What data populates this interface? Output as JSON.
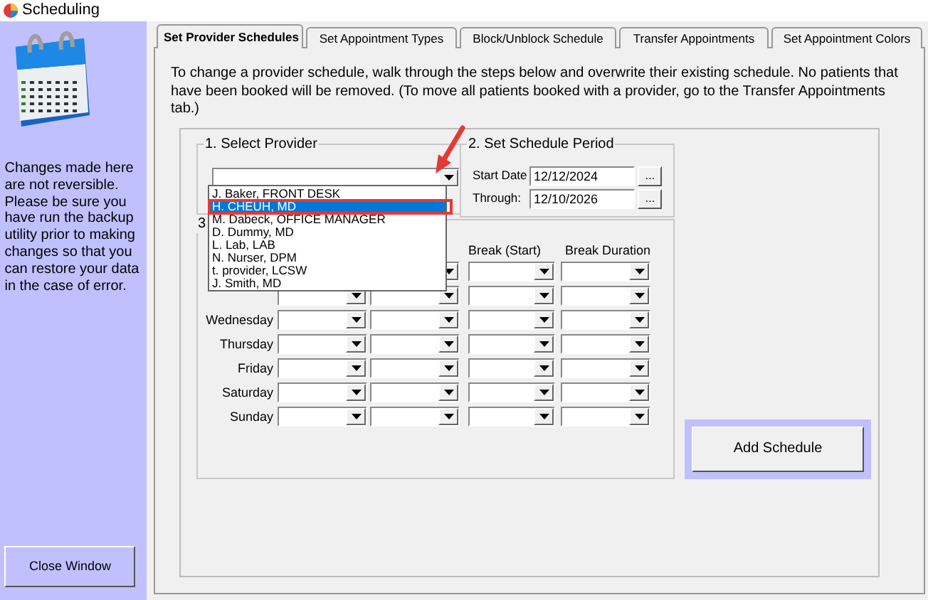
{
  "window": {
    "title": "Scheduling"
  },
  "sidebar": {
    "note": "Changes made here are not reversible. Please be sure you have run the backup utility prior to making changes so that you can restore your data in the case of error.",
    "close_button": {
      "label": "Close Window"
    }
  },
  "tabs": [
    {
      "label": "Set Provider Schedules",
      "selected": true
    },
    {
      "label": "Set Appointment Types",
      "selected": false
    },
    {
      "label": "Block/Unblock Schedule",
      "selected": false
    },
    {
      "label": "Transfer Appointments",
      "selected": false
    },
    {
      "label": "Set Appointment Colors",
      "selected": false
    }
  ],
  "instructions": "To change a provider schedule, walk through the steps below and overwrite their existing schedule. No patients that have been booked will be removed. (To move all patients booked with a provider, go to the Transfer Appointments tab.)",
  "select_provider": {
    "title": "1. Select Provider",
    "expanded": true,
    "options": [
      {
        "label": "J. Baker, FRONT DESK",
        "selected": false
      },
      {
        "label": "H. CHEUH, MD",
        "selected": true
      },
      {
        "label": "M. Dabeck, OFFICE MANAGER",
        "selected": false
      },
      {
        "label": "D. Dummy, MD",
        "selected": false
      },
      {
        "label": "L. Lab, LAB",
        "selected": false
      },
      {
        "label": "N. Nurser, DPM",
        "selected": false
      },
      {
        "label": "t. provider, LCSW",
        "selected": false
      },
      {
        "label": "J. Smith, MD",
        "selected": false
      }
    ]
  },
  "schedule_period": {
    "title": "2. Set Schedule Period",
    "start_label": "Start Date",
    "start_value": "12/12/2024",
    "through_label": "Through:",
    "through_value": "12/10/2026",
    "picker_label": "..."
  },
  "weekly_schedule": {
    "title": "3",
    "columns": [
      "Break (Start)",
      "Break Duration"
    ],
    "rows": [
      {},
      {},
      {
        "day": "Wednesday"
      },
      {
        "day": "Thursday"
      },
      {
        "day": "Friday"
      },
      {
        "day": "Saturday"
      },
      {
        "day": "Sunday"
      }
    ]
  },
  "add_button": {
    "label": "Add Schedule",
    "focused": true
  },
  "annotation": {
    "kind": "arrow"
  }
}
